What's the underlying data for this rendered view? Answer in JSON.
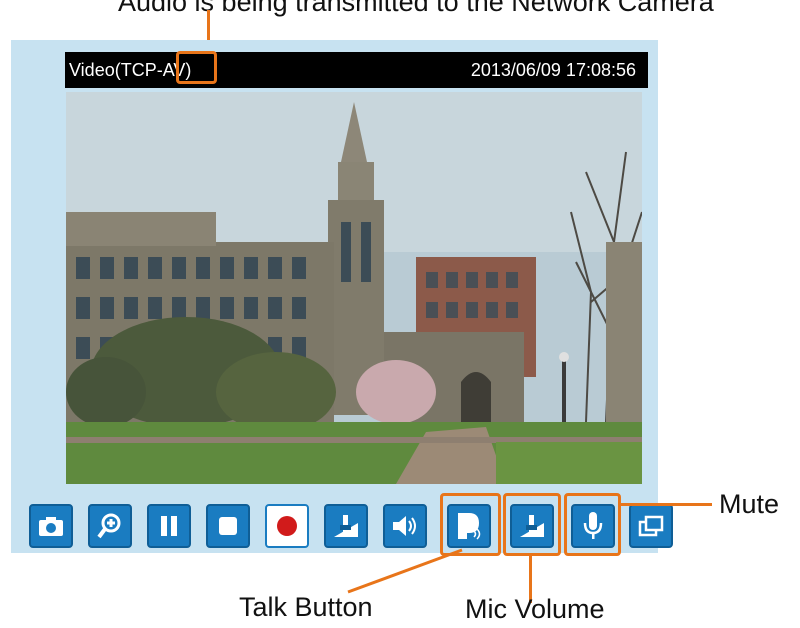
{
  "annotations": {
    "top": "Audio is being transmitted to the Network Camera",
    "mute": "Mute",
    "talk": "Talk Button",
    "mic_volume": "Mic Volume"
  },
  "osd": {
    "left_text": "Video(TCP-AV)",
    "right_text": "2013/06/09  17:08:56"
  },
  "toolbar": {
    "buttons": [
      {
        "name": "snapshot",
        "icon": "camera-icon"
      },
      {
        "name": "digital-zoom",
        "icon": "zoom-in-icon"
      },
      {
        "name": "pause",
        "icon": "pause-icon"
      },
      {
        "name": "stop",
        "icon": "stop-icon"
      },
      {
        "name": "record",
        "icon": "record-icon"
      },
      {
        "name": "volume",
        "icon": "volume-slider-icon"
      },
      {
        "name": "speaker",
        "icon": "speaker-icon"
      },
      {
        "name": "talk",
        "icon": "talk-icon"
      },
      {
        "name": "mic-volume",
        "icon": "mic-volume-icon"
      },
      {
        "name": "mute",
        "icon": "microphone-icon"
      },
      {
        "name": "full-screen",
        "icon": "fullscreen-icon"
      }
    ]
  },
  "colors": {
    "accent": "#e8751a",
    "button": "#1a7cc1",
    "panel": "#c7e2f1"
  }
}
